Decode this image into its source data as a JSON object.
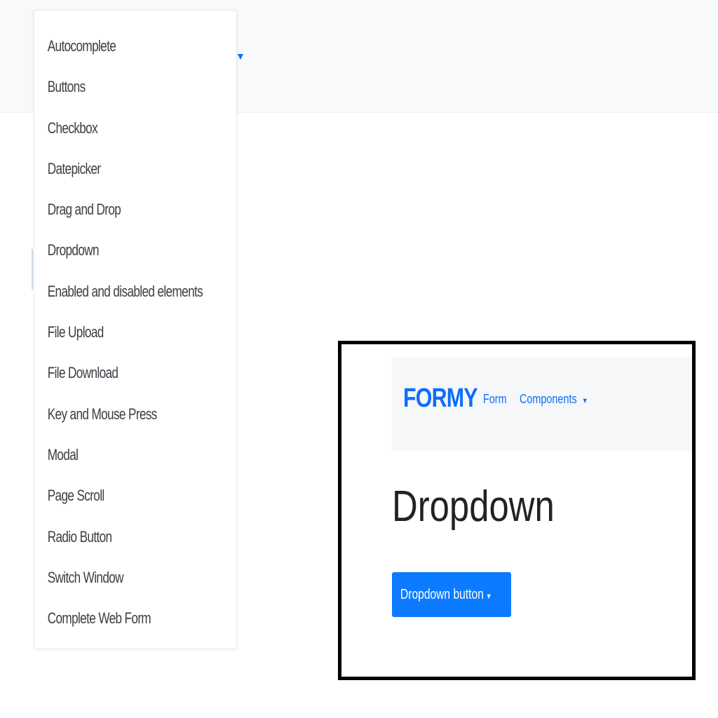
{
  "navbar": {
    "caret": "▼"
  },
  "dropdown": {
    "items": [
      "Autocomplete",
      "Buttons",
      "Checkbox",
      "Datepicker",
      "Drag and Drop",
      "Dropdown",
      "Enabled and disabled elements",
      "File Upload",
      "File Download",
      "Key and Mouse Press",
      "Modal",
      "Page Scroll",
      "Radio Button",
      "Switch Window",
      "Complete Web Form"
    ]
  },
  "inset": {
    "brand": "FORMY",
    "links": [
      "Form",
      "Components"
    ],
    "caret": "▼",
    "heading": "Dropdown",
    "button_label": "Dropdown button",
    "colors": {
      "accent": "#0d6efd",
      "button": "#0d7bff"
    }
  }
}
